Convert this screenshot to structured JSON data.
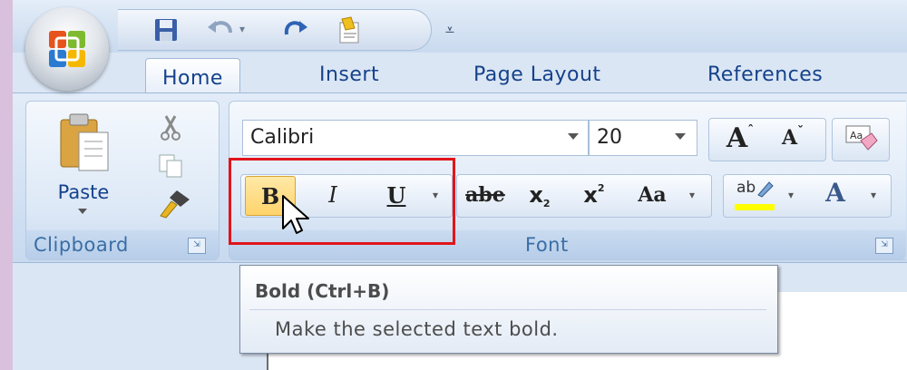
{
  "quick_access": {
    "icons": [
      "save-icon",
      "undo-icon",
      "redo-icon",
      "repeat-format-icon",
      "customize-qat-icon"
    ]
  },
  "tabs": [
    {
      "label": "Home",
      "active": true
    },
    {
      "label": "Insert",
      "active": false
    },
    {
      "label": "Page Layout",
      "active": false
    },
    {
      "label": "References",
      "active": false
    }
  ],
  "clipboard": {
    "paste_label": "Paste",
    "group_label": "Clipboard"
  },
  "font": {
    "font_name": "Calibri",
    "font_size": "20",
    "group_label": "Font",
    "bold_glyph": "B",
    "italic_glyph": "I",
    "underline_glyph": "U",
    "strike_glyph": "abe",
    "subscript_glyph": "x",
    "subscript_mark": "2",
    "superscript_glyph": "x",
    "superscript_mark": "2",
    "change_case_glyph": "Aa",
    "grow_glyph": "A",
    "shrink_glyph": "A",
    "highlight_glyph": "ab",
    "font_color_glyph": "A"
  },
  "tooltip": {
    "title": "Bold (Ctrl+B)",
    "description": "Make the selected text bold."
  },
  "colors": {
    "accent": "#15428b",
    "highlight_bar": "#ffff00",
    "font_color_bar": "#e00000",
    "callout_border": "#e0151b"
  }
}
